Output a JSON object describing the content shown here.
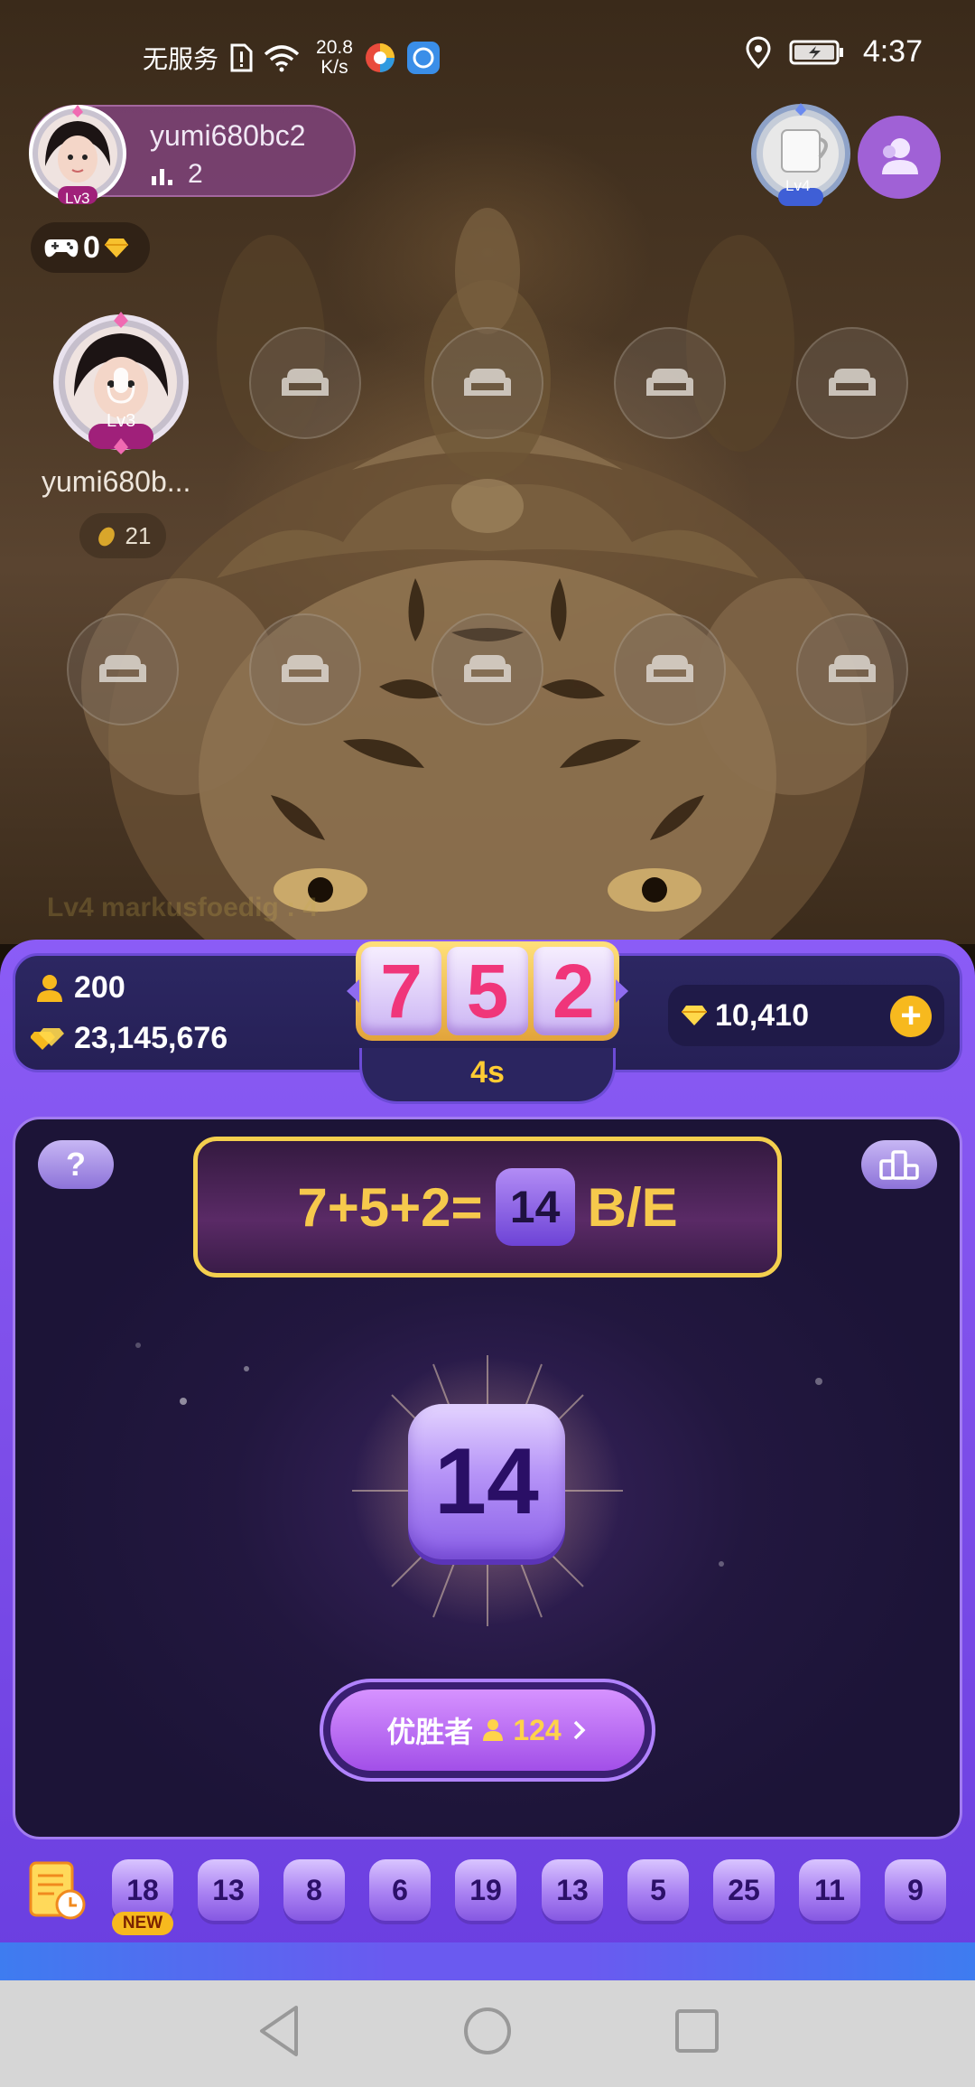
{
  "status_bar": {
    "carrier": "无服务",
    "net_speed_value": "20.8",
    "net_speed_unit": "K/s",
    "time": "4:37",
    "icons": [
      "sim-alert-icon",
      "wifi-icon",
      "browser-app-icon",
      "app-icon",
      "location-icon",
      "battery-charging-icon"
    ]
  },
  "host": {
    "username": "yumi680bc2",
    "level": "Lv3",
    "fan_count": "2"
  },
  "game_chip": {
    "count": "0"
  },
  "top_right": {
    "level": "Lv4"
  },
  "mic_seat": {
    "level": "Lv3",
    "name": "yumi680b...",
    "coins": "21"
  },
  "ghost_text": {
    "level": "Lv4",
    "text": "markusfoedig : 4"
  },
  "game": {
    "players_value": "200",
    "pool_value": "23,145,676",
    "reels": [
      "7",
      "5",
      "2"
    ],
    "countdown": "4s",
    "gems": "10,410",
    "equation": "7+5+2=",
    "equation_result": "14",
    "equation_suffix": "B/E",
    "result_number": "14",
    "winners_label": "优胜者",
    "winners_count": "124",
    "history": [
      "18",
      "13",
      "8",
      "6",
      "19",
      "13",
      "5",
      "25",
      "11",
      "9"
    ],
    "new_tag": "NEW"
  },
  "colors": {
    "panel_purple": "#7c4de8",
    "reel_digit": "#f0367a",
    "gold": "#f6c94c",
    "accent_yellow": "#f7b91e"
  }
}
